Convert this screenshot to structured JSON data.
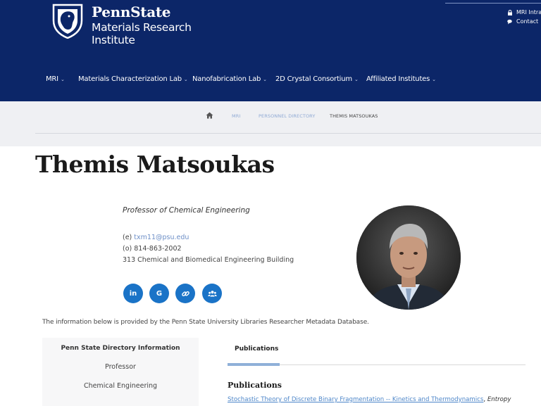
{
  "header": {
    "logo_line1": "PennState",
    "logo_line2": "Materials Research",
    "logo_line3": "Institute",
    "utility": [
      {
        "label": "MRI Intranet",
        "icon": "lock-icon"
      },
      {
        "label": "Contact",
        "icon": "chat-icon"
      }
    ],
    "nav": [
      {
        "label": "MRI",
        "caret": "⌄"
      },
      {
        "label": "Materials Characterization Lab",
        "caret": "⌄"
      },
      {
        "label": "Nanofabrication Lab",
        "caret": "⌄"
      },
      {
        "label": "2D Crystal Consortium",
        "caret": "⌄"
      },
      {
        "label": "Affiliated Institutes",
        "caret": "⌄"
      }
    ],
    "colors": {
      "background": "#0c2668"
    }
  },
  "breadcrumb": {
    "home_icon": "home-icon",
    "items": [
      "MRI",
      "PERSONNEL DIRECTORY"
    ],
    "current": "THEMIS MATSOUKAS"
  },
  "profile": {
    "name": "Themis Matsoukas",
    "title": "Professor of Chemical Engineering",
    "email_prefix": "(e)",
    "email": "txm11@psu.edu",
    "phone": "(o) 814-863-2002",
    "office": "313 Chemical and Biomedical Engineering Building",
    "social": [
      {
        "icon": "linkedin-icon",
        "glyph": "in"
      },
      {
        "icon": "google-icon",
        "glyph": "G"
      },
      {
        "icon": "link-icon",
        "glyph": ""
      },
      {
        "icon": "group-icon",
        "glyph": ""
      }
    ],
    "accent": "#1a73c7"
  },
  "source_note": "The information below is provided by the Penn State University Libraries Researcher Metadata Database.",
  "directory": {
    "title": "Penn State Directory Information",
    "items": [
      "Professor",
      "Chemical Engineering"
    ]
  },
  "publications": {
    "tab_label": "Publications",
    "heading": "Publications",
    "first_title": "Stochastic Theory of Discrete Binary Fragmentation -- Kinetics and Thermodynamics",
    "first_sep": ",",
    "first_journal": "Entropy"
  }
}
